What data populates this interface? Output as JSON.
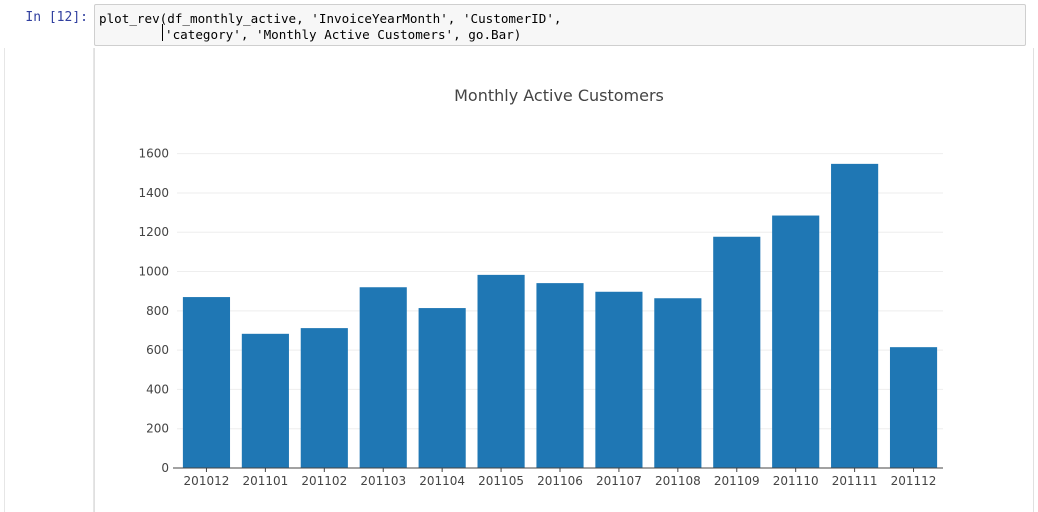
{
  "cell": {
    "prompt": "In [12]:",
    "code_line_1": "plot_rev(df_monthly_active, 'InvoiceYearMonth', 'CustomerID',",
    "code_line_2": "'category', 'Monthly Active Customers', go.Bar)"
  },
  "chart_data": {
    "type": "bar",
    "title": "Monthly Active Customers",
    "categories": [
      "201012",
      "201101",
      "201102",
      "201103",
      "201104",
      "201105",
      "201106",
      "201107",
      "201108",
      "201109",
      "201110",
      "201111",
      "201112"
    ],
    "values": [
      870,
      683,
      712,
      920,
      814,
      983,
      941,
      897,
      864,
      1177,
      1285,
      1548,
      615
    ],
    "ylim": [
      0,
      1700
    ],
    "yticks": [
      0,
      200,
      400,
      600,
      800,
      1000,
      1200,
      1400,
      1600
    ],
    "grid": true,
    "bar_color": "#1f77b4",
    "grid_color": "#eeeeee",
    "xlabel": "",
    "ylabel": ""
  }
}
